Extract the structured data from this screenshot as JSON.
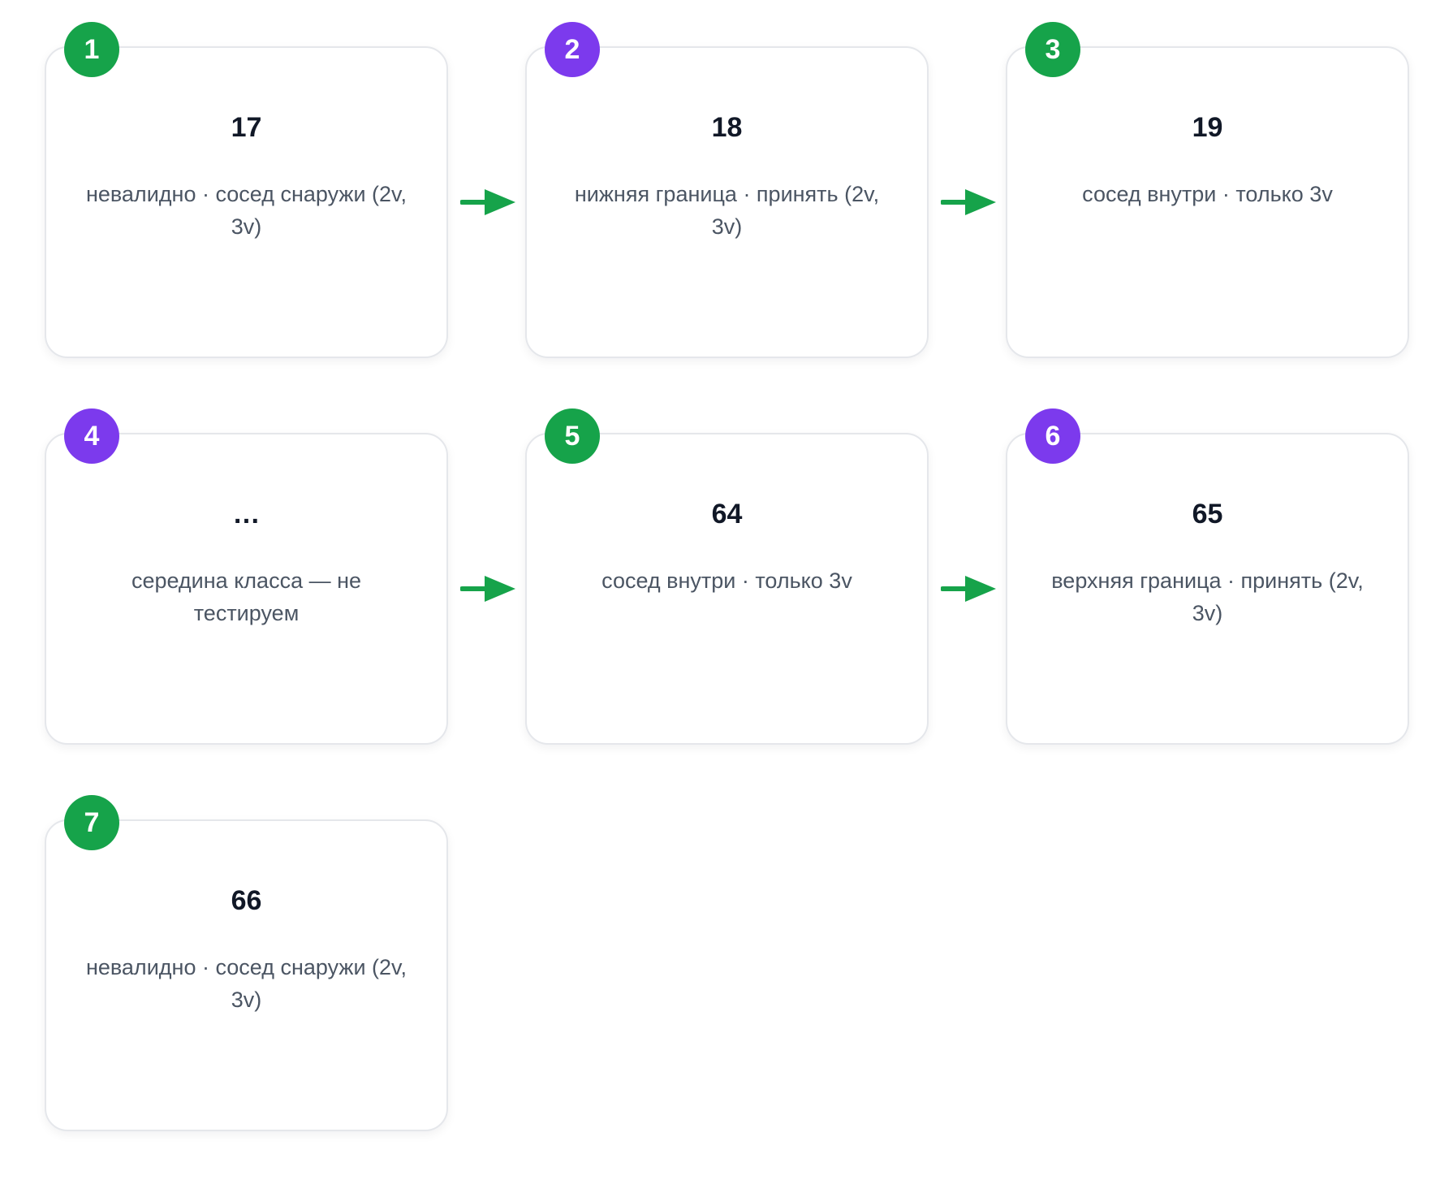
{
  "colors": {
    "accent_green": "#16a34a",
    "accent_purple": "#7c3aed"
  },
  "steps": [
    {
      "badge": "1",
      "value": "17",
      "note": "невалидно · сосед снаружи (2v, 3v)",
      "badge_color": "#16a34a"
    },
    {
      "badge": "2",
      "value": "18",
      "note": "нижняя граница · принять (2v, 3v)",
      "badge_color": "#7c3aed"
    },
    {
      "badge": "3",
      "value": "19",
      "note": "сосед внутри · только 3v",
      "badge_color": "#16a34a"
    },
    {
      "badge": "4",
      "value": "…",
      "note": "середина класса — не тестируем",
      "badge_color": "#7c3aed"
    },
    {
      "badge": "5",
      "value": "64",
      "note": "сосед внутри · только 3v",
      "badge_color": "#16a34a"
    },
    {
      "badge": "6",
      "value": "65",
      "note": "верхняя граница · принять (2v, 3v)",
      "badge_color": "#7c3aed"
    },
    {
      "badge": "7",
      "value": "66",
      "note": "невалидно · сосед снаружи (2v, 3v)",
      "badge_color": "#16a34a"
    }
  ],
  "arrows": [
    {
      "from": 1,
      "to": 2
    },
    {
      "from": 2,
      "to": 3
    },
    {
      "from": 4,
      "to": 5
    },
    {
      "from": 5,
      "to": 6
    }
  ]
}
